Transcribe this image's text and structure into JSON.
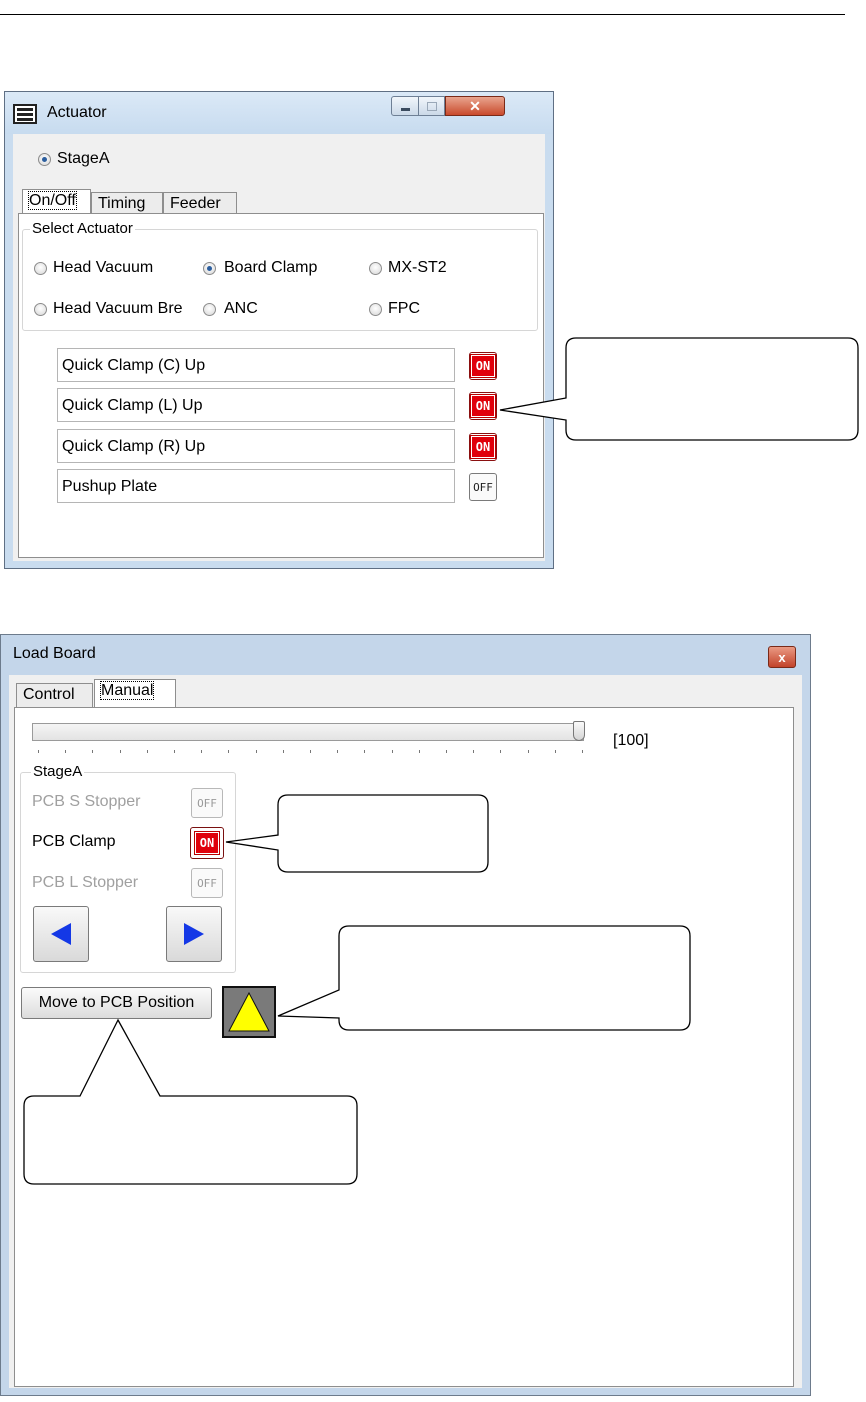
{
  "actuator_window": {
    "title": "Actuator",
    "stage": {
      "label": "StageA",
      "selected": true
    },
    "tabs": [
      {
        "label": "On/Off",
        "active": true
      },
      {
        "label": "Timing",
        "active": false
      },
      {
        "label": "Feeder",
        "active": false
      }
    ],
    "select_group_title": "Select Actuator",
    "actuators": [
      {
        "label": "Head Vacuum",
        "selected": false
      },
      {
        "label": "Board Clamp",
        "selected": true
      },
      {
        "label": "MX-ST2",
        "selected": false
      },
      {
        "label": "Head Vacuum Bre",
        "selected": false
      },
      {
        "label": "ANC",
        "selected": false
      },
      {
        "label": "FPC",
        "selected": false
      }
    ],
    "rows": [
      {
        "label": "Quick Clamp (C) Up",
        "state": "ON"
      },
      {
        "label": "Quick Clamp (L) Up",
        "state": "ON"
      },
      {
        "label": "Quick Clamp (R) Up",
        "state": "ON"
      },
      {
        "label": "Pushup Plate",
        "state": "OFF"
      }
    ]
  },
  "load_board_window": {
    "title": "Load Board",
    "close_glyph": "x",
    "tabs": [
      {
        "label": "Control",
        "active": false
      },
      {
        "label": "Manual",
        "active": true
      }
    ],
    "speed_value_text": "[100]",
    "speed_percent": 100,
    "stage_group_title": "StageA",
    "stage_rows": [
      {
        "label": "PCB S Stopper",
        "state": "OFF",
        "enabled": false
      },
      {
        "label": "PCB Clamp",
        "state": "ON",
        "enabled": true
      },
      {
        "label": "PCB L Stopper",
        "state": "OFF",
        "enabled": false
      }
    ],
    "move_button_label": "Move to PCB Position"
  },
  "colors": {
    "on_red": "#e0000b",
    "arrow_blue": "#1438e6",
    "warning_yellow": "#ffff00"
  },
  "icons": [
    "actuator-window-icon",
    "minimize-icon",
    "maximize-icon",
    "close-icon",
    "left-arrow-icon",
    "right-arrow-icon",
    "warning-triangle-icon"
  ]
}
